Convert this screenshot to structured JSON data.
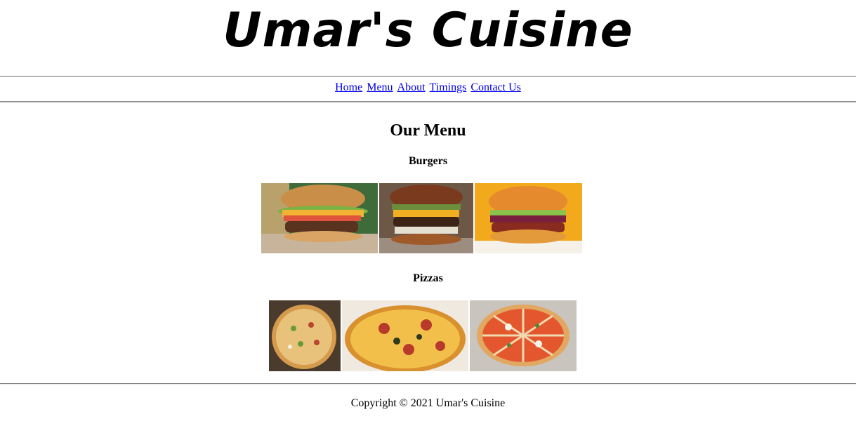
{
  "header": {
    "logo_text": "Umar's Cuisine"
  },
  "nav": {
    "items": [
      {
        "label": "Home"
      },
      {
        "label": "Menu"
      },
      {
        "label": "About"
      },
      {
        "label": "Timings"
      },
      {
        "label": "Contact Us"
      }
    ]
  },
  "main": {
    "title": "Our Menu",
    "sections": [
      {
        "title": "Burgers"
      },
      {
        "title": "Pizzas"
      }
    ]
  },
  "footer": {
    "copyright": "Copyright © 2021 Umar's Cuisine"
  },
  "colors": {
    "link": "#0000ee",
    "rule": "#808080"
  }
}
